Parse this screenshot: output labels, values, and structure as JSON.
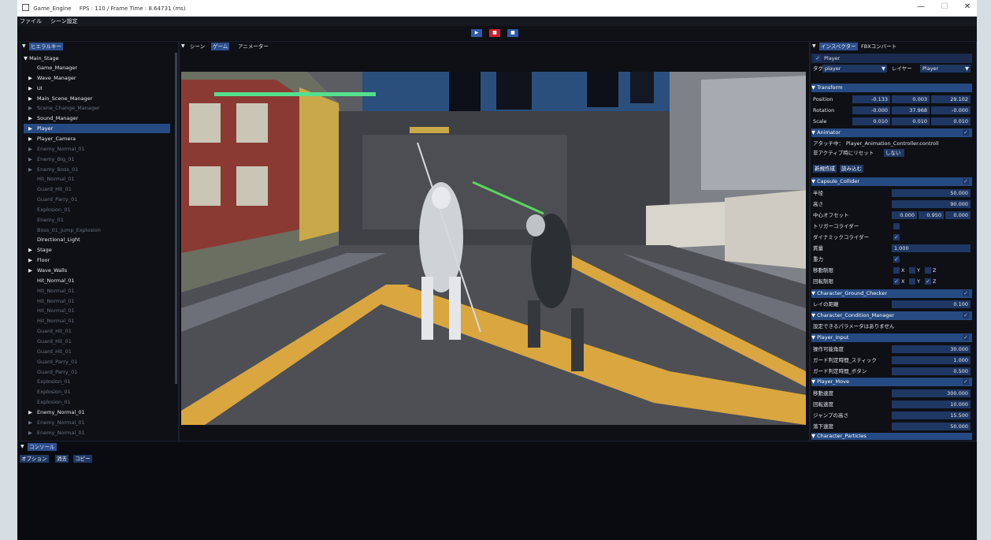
{
  "window": {
    "title": "Game_Engine",
    "stats": "FPS : 110 / Frame Time : 8.64731 (ms)",
    "minimize": "—",
    "maximize": "☐",
    "close": "✕"
  },
  "menu": {
    "file": "ファイル",
    "scene_settings": "シーン設定"
  },
  "playbar": {
    "play": "▶",
    "stop": "■",
    "pause": "■"
  },
  "hierarchy": {
    "tab": "ヒエラルキー",
    "root": "Main_Stage",
    "items": [
      {
        "label": "Game_Manager",
        "style": "bright",
        "arrow": ""
      },
      {
        "label": "Wave_Manager",
        "style": "bright",
        "arrow": "▶"
      },
      {
        "label": "UI",
        "style": "bright",
        "arrow": "▶"
      },
      {
        "label": "Main_Scene_Manager",
        "style": "bright",
        "arrow": "▶"
      },
      {
        "label": "Scene_Change_Manager",
        "style": "dim",
        "arrow": "▶"
      },
      {
        "label": "Sound_Manager",
        "style": "bright",
        "arrow": "▶"
      },
      {
        "label": "Player",
        "style": "sel",
        "arrow": "▶"
      },
      {
        "label": "Player_Camera",
        "style": "bright",
        "arrow": "▶"
      },
      {
        "label": "Enemy_Normal_01",
        "style": "dim",
        "arrow": "▶"
      },
      {
        "label": "Enemy_Big_01",
        "style": "dim",
        "arrow": "▶"
      },
      {
        "label": "Enemy_Boss_01",
        "style": "dim",
        "arrow": "▶"
      },
      {
        "label": "Hit_Normal_01",
        "style": "dim",
        "arrow": ""
      },
      {
        "label": "Guard_Hit_01",
        "style": "dim",
        "arrow": ""
      },
      {
        "label": "Guard_Parry_01",
        "style": "dim",
        "arrow": ""
      },
      {
        "label": "Explosion_01",
        "style": "dim",
        "arrow": ""
      },
      {
        "label": "Enemy_01",
        "style": "dim",
        "arrow": ""
      },
      {
        "label": "Boss_01_Jump_Explosion",
        "style": "dim",
        "arrow": ""
      },
      {
        "label": "Directional_Light",
        "style": "bright",
        "arrow": ""
      },
      {
        "label": "Stage",
        "style": "bright",
        "arrow": "▶"
      },
      {
        "label": "Floor",
        "style": "bright",
        "arrow": "▶"
      },
      {
        "label": "Wave_Walls",
        "style": "bright",
        "arrow": "▶"
      },
      {
        "label": "Hit_Normal_01",
        "style": "bright",
        "arrow": ""
      },
      {
        "label": "Hit_Normal_01",
        "style": "dim",
        "arrow": ""
      },
      {
        "label": "Hit_Normal_01",
        "style": "dim",
        "arrow": ""
      },
      {
        "label": "Hit_Normal_01",
        "style": "dim",
        "arrow": ""
      },
      {
        "label": "Hit_Normal_01",
        "style": "dim",
        "arrow": ""
      },
      {
        "label": "Guard_Hit_01",
        "style": "dim",
        "arrow": ""
      },
      {
        "label": "Guard_Hit_01",
        "style": "dim",
        "arrow": ""
      },
      {
        "label": "Guard_Hit_01",
        "style": "dim",
        "arrow": ""
      },
      {
        "label": "Guard_Parry_01",
        "style": "dim",
        "arrow": ""
      },
      {
        "label": "Guard_Parry_01",
        "style": "dim",
        "arrow": ""
      },
      {
        "label": "Explosion_01",
        "style": "dim",
        "arrow": ""
      },
      {
        "label": "Explosion_01",
        "style": "dim",
        "arrow": ""
      },
      {
        "label": "Explosion_01",
        "style": "dim",
        "arrow": ""
      },
      {
        "label": "Enemy_Normal_01",
        "style": "bright",
        "arrow": "▶"
      },
      {
        "label": "Enemy_Normal_01",
        "style": "dim",
        "arrow": "▶"
      },
      {
        "label": "Enemy_Normal_01",
        "style": "dim",
        "arrow": "▶"
      }
    ]
  },
  "scene_tabs": {
    "scene": "シーン",
    "game": "ゲーム",
    "animator": "アニメーター"
  },
  "inspector": {
    "tab_inspector": "インスペクター",
    "tab_fbx": "FBXコンバート",
    "object_name": "Player",
    "tag_label": "タグ",
    "tag_value": "player",
    "layer_label": "レイヤー",
    "layer_value": "Player",
    "transform": {
      "header": "Transform",
      "position_label": "Position",
      "position": [
        "-0.133",
        "0.003",
        "29.102"
      ],
      "rotation_label": "Rotation",
      "rotation": [
        "-0.000",
        "37.968",
        "-0.000"
      ],
      "scale_label": "Scale",
      "scale": [
        "0.010",
        "0.010",
        "0.010"
      ]
    },
    "animator": {
      "header": "Animator",
      "attached_label": "アタッチ中：",
      "attached_value": "Player_Animation_Controller.controll",
      "reset_label": "非アクティブ時にリセット",
      "reset_value": "しない",
      "create_button": "新規作成",
      "load_button": "読み込む"
    },
    "capsule": {
      "header": "Capsule_Collider",
      "radius_label": "半径",
      "radius": "50.000",
      "height_label": "高さ",
      "height": "90.000",
      "center_label": "中心オフセット",
      "center": [
        "0.000",
        "0.950",
        "0.000"
      ],
      "trigger_label": "トリガーコライダー",
      "dynamic_label": "ダイナミックコライダー",
      "mass_label": "質量",
      "mass": "1.000",
      "gravity_label": "重力",
      "pos_lock_label": "移動制限",
      "rot_lock_label": "回転制限",
      "axes": [
        "X",
        "Y",
        "Z"
      ]
    },
    "ground": {
      "header": "Character_Ground_Checker",
      "ray_label": "レイの距離",
      "ray": "0.100"
    },
    "condition": {
      "header": "Character_Condition_Manager",
      "note": "設定できるパラメータはありません"
    },
    "input": {
      "header": "Player_Input",
      "rows": [
        {
          "label": "操作可能角度",
          "value": "30.000"
        },
        {
          "label": "ガード判定時間_スティック",
          "value": "1.000"
        },
        {
          "label": "ガード判定時間_ボタン",
          "value": "0.500"
        }
      ]
    },
    "move": {
      "header": "Player_Move",
      "rows": [
        {
          "label": "移動速度",
          "value": "300.000"
        },
        {
          "label": "回転速度",
          "value": "10.000"
        },
        {
          "label": "ジャンプの高さ",
          "value": "15.500"
        },
        {
          "label": "落下速度",
          "value": "50.000"
        }
      ]
    },
    "particles": {
      "header": "Character_Particles"
    }
  },
  "console": {
    "tab": "コンソール",
    "options": "オプション",
    "clear": "消去",
    "copy": "コピー"
  },
  "colors": {
    "accent": "#264a82",
    "field": "#1f3763",
    "panel_bg": "#0e1016",
    "health": "#54e08c"
  }
}
